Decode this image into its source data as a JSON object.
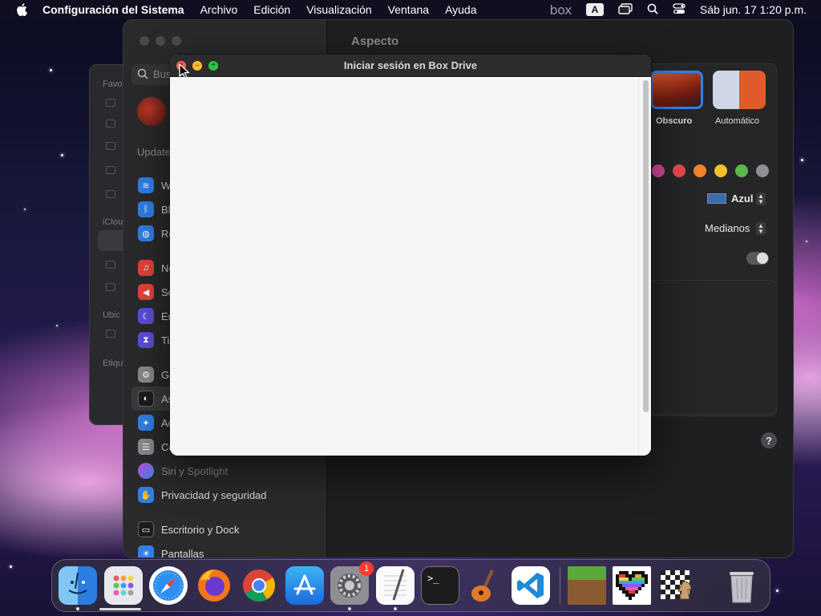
{
  "menubar": {
    "app_name": "Configuración del Sistema",
    "menus": [
      "Archivo",
      "Edición",
      "Visualización",
      "Ventana",
      "Ayuda"
    ],
    "box_logo": "box",
    "input_source": "A",
    "datetime": "Sáb jun. 17  1:20 p.m."
  },
  "finder": {
    "sections": [
      "Favo",
      "iClou",
      "Ubic",
      "Etiqu"
    ]
  },
  "settings": {
    "search_placeholder": "Bus",
    "sections": {
      "updates": "Update"
    },
    "sidebar": [
      {
        "label": "Wi",
        "icon": "wifi-icon",
        "color": "#2f7fe6"
      },
      {
        "label": "Bl",
        "icon": "bluetooth-icon",
        "color": "#2f7fe6"
      },
      {
        "label": "Re",
        "icon": "globe-icon",
        "color": "#2f7fe6"
      },
      {
        "label": "No",
        "icon": "bell-icon",
        "color": "#e0453a"
      },
      {
        "label": "So",
        "icon": "speaker-icon",
        "color": "#e0453a"
      },
      {
        "label": "En",
        "icon": "moon-icon",
        "color": "#5b4fd6"
      },
      {
        "label": "Ti",
        "icon": "hourglass-icon",
        "color": "#5b4fd6"
      },
      {
        "label": "Ge",
        "icon": "gear-icon",
        "color": "#8a8a8e"
      },
      {
        "label": "As",
        "icon": "appearance-icon",
        "color": "#1c1c1e"
      },
      {
        "label": "Ac",
        "icon": "accessibility-icon",
        "color": "#2f7fe6"
      },
      {
        "label": "Ce",
        "icon": "control-center-icon",
        "color": "#8a8a8e"
      },
      {
        "label": "Siri y Spotlight",
        "icon": "siri-icon",
        "color": "#c04be0"
      },
      {
        "label": "Privacidad y seguridad",
        "icon": "hand-icon",
        "color": "#2f7fe6"
      },
      {
        "label": "Escritorio y Dock",
        "icon": "dock-icon",
        "color": "#1c1c1e"
      },
      {
        "label": "Pantallas",
        "icon": "sun-icon",
        "color": "#2f7fe6"
      }
    ],
    "main": {
      "title": "Aspecto",
      "theme_dark": "Obscuro",
      "theme_auto": "Automático",
      "accent_colors": [
        "#d9489a",
        "#e5484d",
        "#f0832b",
        "#f2c12e",
        "#5ab84b",
        "#8e8e93"
      ],
      "highlight_value": "Azul",
      "highlight_swatch": "#3d6ca8",
      "sidebar_icon_size": "Medianos",
      "help": "?"
    }
  },
  "dialog": {
    "title": "Iniciar sesión en Box Drive"
  },
  "dock": {
    "apps": [
      {
        "name": "finder-icon",
        "running": true
      },
      {
        "name": "launchpad-icon",
        "running": false
      },
      {
        "name": "safari-icon",
        "running": false
      },
      {
        "name": "firefox-icon",
        "running": false
      },
      {
        "name": "chrome-icon",
        "running": false
      },
      {
        "name": "app-store-icon",
        "running": false
      },
      {
        "name": "system-settings-icon",
        "running": true,
        "badge": "1"
      },
      {
        "name": "textedit-icon",
        "running": true
      },
      {
        "name": "terminal-icon",
        "running": false
      },
      {
        "name": "garageband-icon",
        "running": false
      },
      {
        "name": "vscode-icon",
        "running": false
      },
      {
        "name": "minecraft-icon",
        "running": false
      },
      {
        "name": "pixel-heart-icon",
        "running": false
      },
      {
        "name": "chess-icon",
        "running": false
      },
      {
        "name": "trash-icon",
        "running": false
      }
    ]
  }
}
